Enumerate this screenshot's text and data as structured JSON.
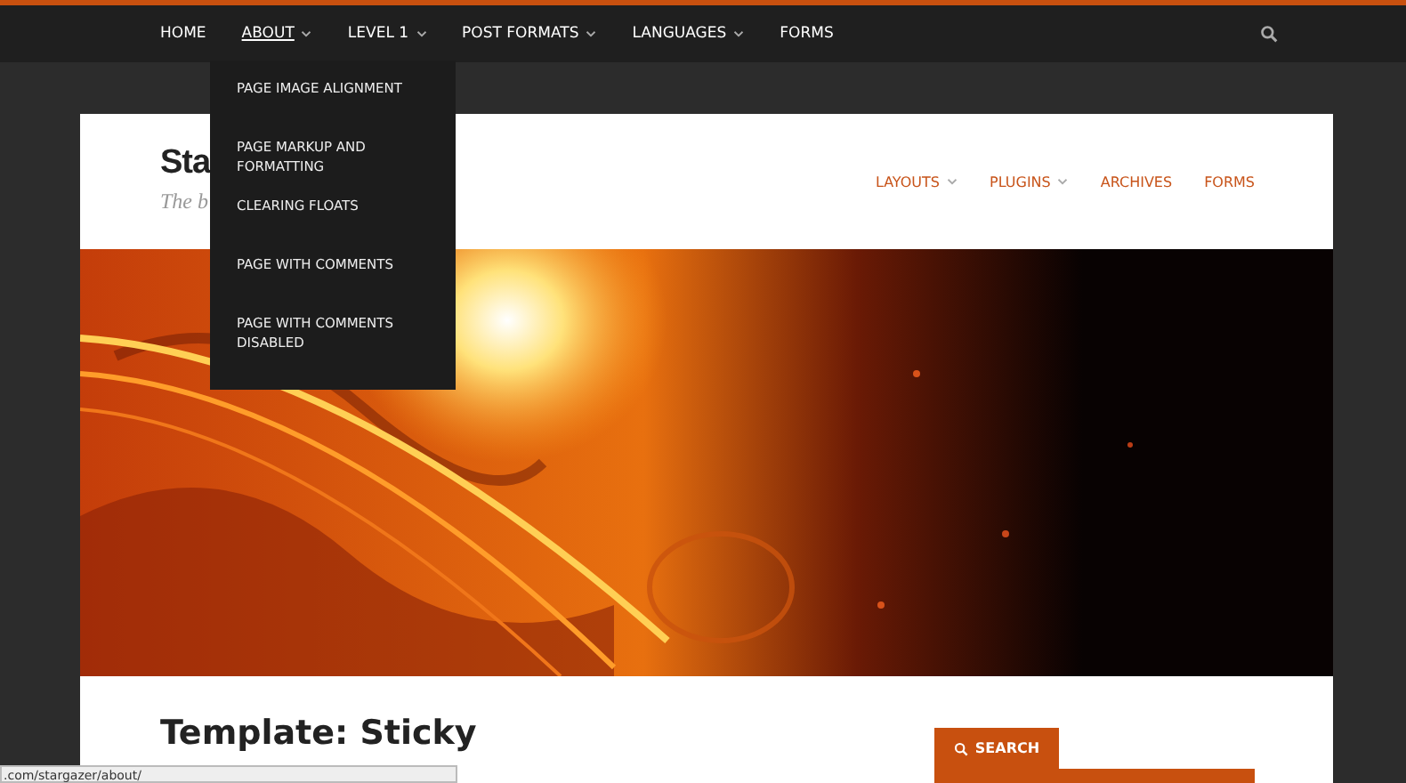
{
  "top_nav": {
    "items": [
      {
        "label": "HOME",
        "submenu": false,
        "selected": false
      },
      {
        "label": "ABOUT",
        "submenu": true,
        "selected": true
      },
      {
        "label": "LEVEL 1",
        "submenu": true,
        "selected": false
      },
      {
        "label": "POST FORMATS",
        "submenu": true,
        "selected": false
      },
      {
        "label": "LANGUAGES",
        "submenu": true,
        "selected": false
      },
      {
        "label": "FORMS",
        "submenu": false,
        "selected": false
      }
    ]
  },
  "dropdown": {
    "items": [
      "PAGE IMAGE ALIGNMENT",
      "PAGE MARKUP AND FORMATTING",
      "CLEARING FLOATS",
      "PAGE WITH COMMENTS",
      "PAGE WITH COMMENTS DISABLED"
    ]
  },
  "site": {
    "title": "Sta",
    "tagline": "The b"
  },
  "site_nav": {
    "items": [
      {
        "label": "LAYOUTS",
        "submenu": true
      },
      {
        "label": "PLUGINS",
        "submenu": true
      },
      {
        "label": "ARCHIVES",
        "submenu": false
      },
      {
        "label": "FORMS",
        "submenu": false
      }
    ]
  },
  "post": {
    "title": "Template: Sticky"
  },
  "sidebar": {
    "search_label": "SEARCH"
  },
  "status_bar": {
    "url": ".com/stargazer/about/"
  }
}
